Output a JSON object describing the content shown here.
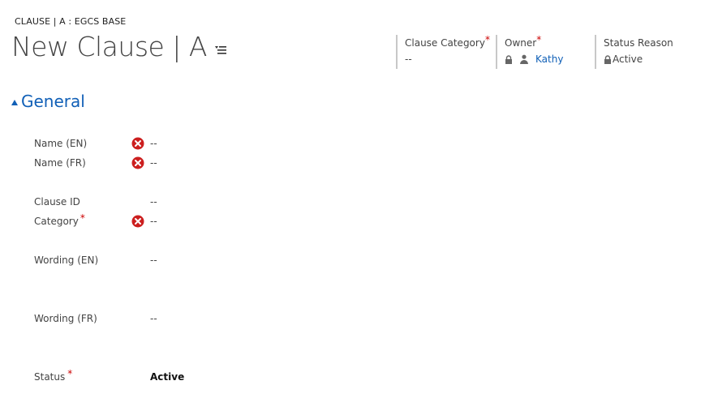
{
  "breadcrumb": "CLAUSE | A : EGCS BASE",
  "title": "New Clause | A",
  "header": {
    "clause_category": {
      "label": "Clause Category",
      "required": "*",
      "value": "--"
    },
    "owner": {
      "label": "Owner",
      "required": "*",
      "value": "Kathy"
    },
    "status_reason": {
      "label": "Status Reason",
      "value": "Active"
    }
  },
  "section": {
    "title": "General"
  },
  "fields": {
    "name_en": {
      "label": "Name (EN)",
      "value": "--"
    },
    "name_fr": {
      "label": "Name (FR)",
      "value": "--"
    },
    "clause_id": {
      "label": "Clause ID",
      "value": "--"
    },
    "category": {
      "label": "Category",
      "required": "*",
      "value": "--"
    },
    "wording_en": {
      "label": "Wording (EN)",
      "value": "--"
    },
    "wording_fr": {
      "label": "Wording (FR)",
      "value": "--"
    },
    "status": {
      "label": "Status",
      "required": "*",
      "value": "Active"
    }
  },
  "icons": {
    "error": "error-circle-icon",
    "lock": "lock-icon",
    "user": "user-icon",
    "menu": "form-menu-icon",
    "collapse": "collapse-triangle-icon"
  },
  "colors": {
    "accent": "#1160b7",
    "error": "#cc1f1f",
    "required": "#cc0000"
  }
}
